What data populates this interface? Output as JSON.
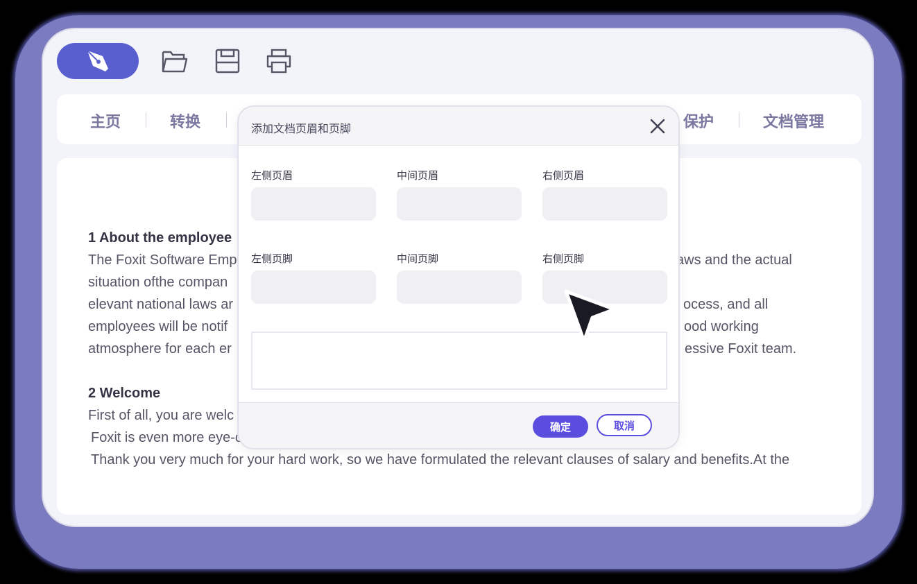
{
  "toolbar": {
    "logo_icon": "pen-nib-icon",
    "icons": [
      "open-folder-icon",
      "save-icon",
      "print-icon"
    ]
  },
  "nav": {
    "items": [
      {
        "label": "主页"
      },
      {
        "label": "转换"
      },
      {
        "label": "保护"
      },
      {
        "label": "文档管理"
      }
    ]
  },
  "document": {
    "lines": [
      "1 About the employee",
      "The Foxit Software Emp",
      "aws and the actual",
      "situation ofthe compan",
      "elevant national laws ar",
      "ocess, and all",
      "employees will be notif",
      "ood working",
      "atmosphere for each er",
      "essive Foxit team.",
      "2 Welcome",
      "First of all, you are welc",
      "Foxit is even more eye-c",
      "Thank you very much for your hard work, so we have formulated the relevant clauses of salary and benefits.At the"
    ]
  },
  "dialog": {
    "title": "添加文档页眉和页脚",
    "fields": {
      "left_header": {
        "label": "左侧页眉",
        "value": ""
      },
      "center_header": {
        "label": "中间页眉",
        "value": ""
      },
      "right_header": {
        "label": "右侧页眉",
        "value": ""
      },
      "left_footer": {
        "label": "左侧页脚",
        "value": ""
      },
      "center_footer": {
        "label": "中间页脚",
        "value": ""
      },
      "right_footer": {
        "label": "右侧页脚",
        "value": ""
      }
    },
    "ok_label": "确定",
    "cancel_label": "取消"
  },
  "colors": {
    "accent": "#5b4de0",
    "logo_bg": "#5a5fd0",
    "nav_text": "#7a78a0",
    "outer_glow": "#7b7bc0"
  }
}
